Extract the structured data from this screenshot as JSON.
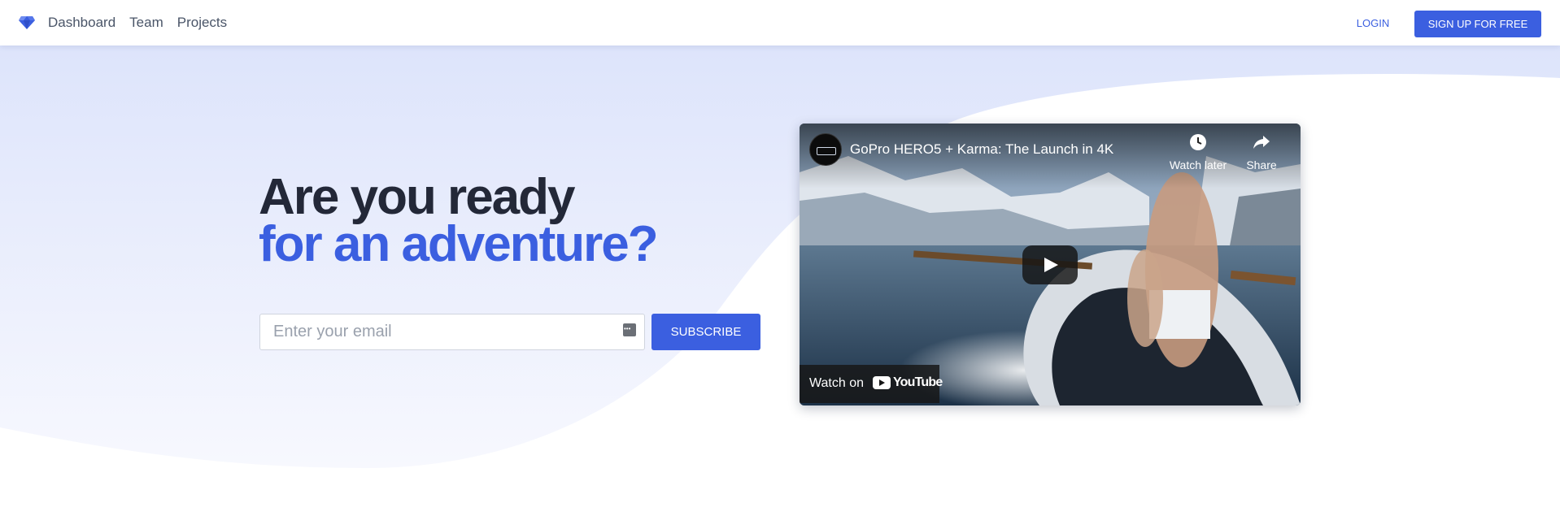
{
  "navbar": {
    "brand_icon": "diamond-icon",
    "links": [
      "Dashboard",
      "Team",
      "Projects"
    ],
    "login_label": "LOGIN",
    "signup_label": "SIGN UP FOR FREE"
  },
  "hero": {
    "headline_line1": "Are you ready",
    "headline_line2": "for an adventure?",
    "email_placeholder": "Enter your email",
    "subscribe_label": "SUBSCRIBE"
  },
  "video": {
    "title": "GoPro HERO5 + Karma: The Launch in 4K",
    "watch_later_label": "Watch later",
    "share_label": "Share",
    "watch_on_label": "Watch on",
    "platform_label": "YouTube"
  },
  "colors": {
    "accent": "#3b5fe0",
    "heading": "#232838",
    "nav_text": "#4a5568",
    "hero_bg": "#dfe6fb"
  }
}
